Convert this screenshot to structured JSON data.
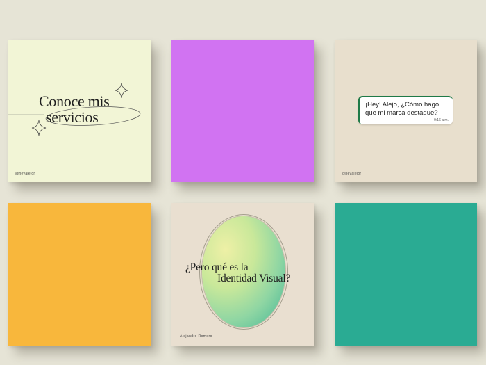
{
  "background": "#e6e4d6",
  "tiles": [
    {
      "id": "t1",
      "color": "#f2f5d6",
      "title_line1": "Conoce mis",
      "title_line2": "servicios",
      "handle": "@heyalejor"
    },
    {
      "id": "t2",
      "color": "#d173f2"
    },
    {
      "id": "t3",
      "color": "#e8dfcd",
      "chat_message": "¡Hey! Alejo, ¿Cómo hago que mi marca destaque?",
      "chat_time": "9:16 a.m.",
      "handle": "@heyalejor",
      "accent": "#1f7a47"
    },
    {
      "id": "t4",
      "color": "#f8b73c"
    },
    {
      "id": "t5",
      "color": "#e9dfd0",
      "title_line1": "¿Pero qué es la",
      "title_line2": "Identidad Visual?",
      "author": "Alejandro Romero"
    },
    {
      "id": "t6",
      "color": "#2aab93"
    }
  ],
  "icons": [
    "sparkle-icon"
  ]
}
